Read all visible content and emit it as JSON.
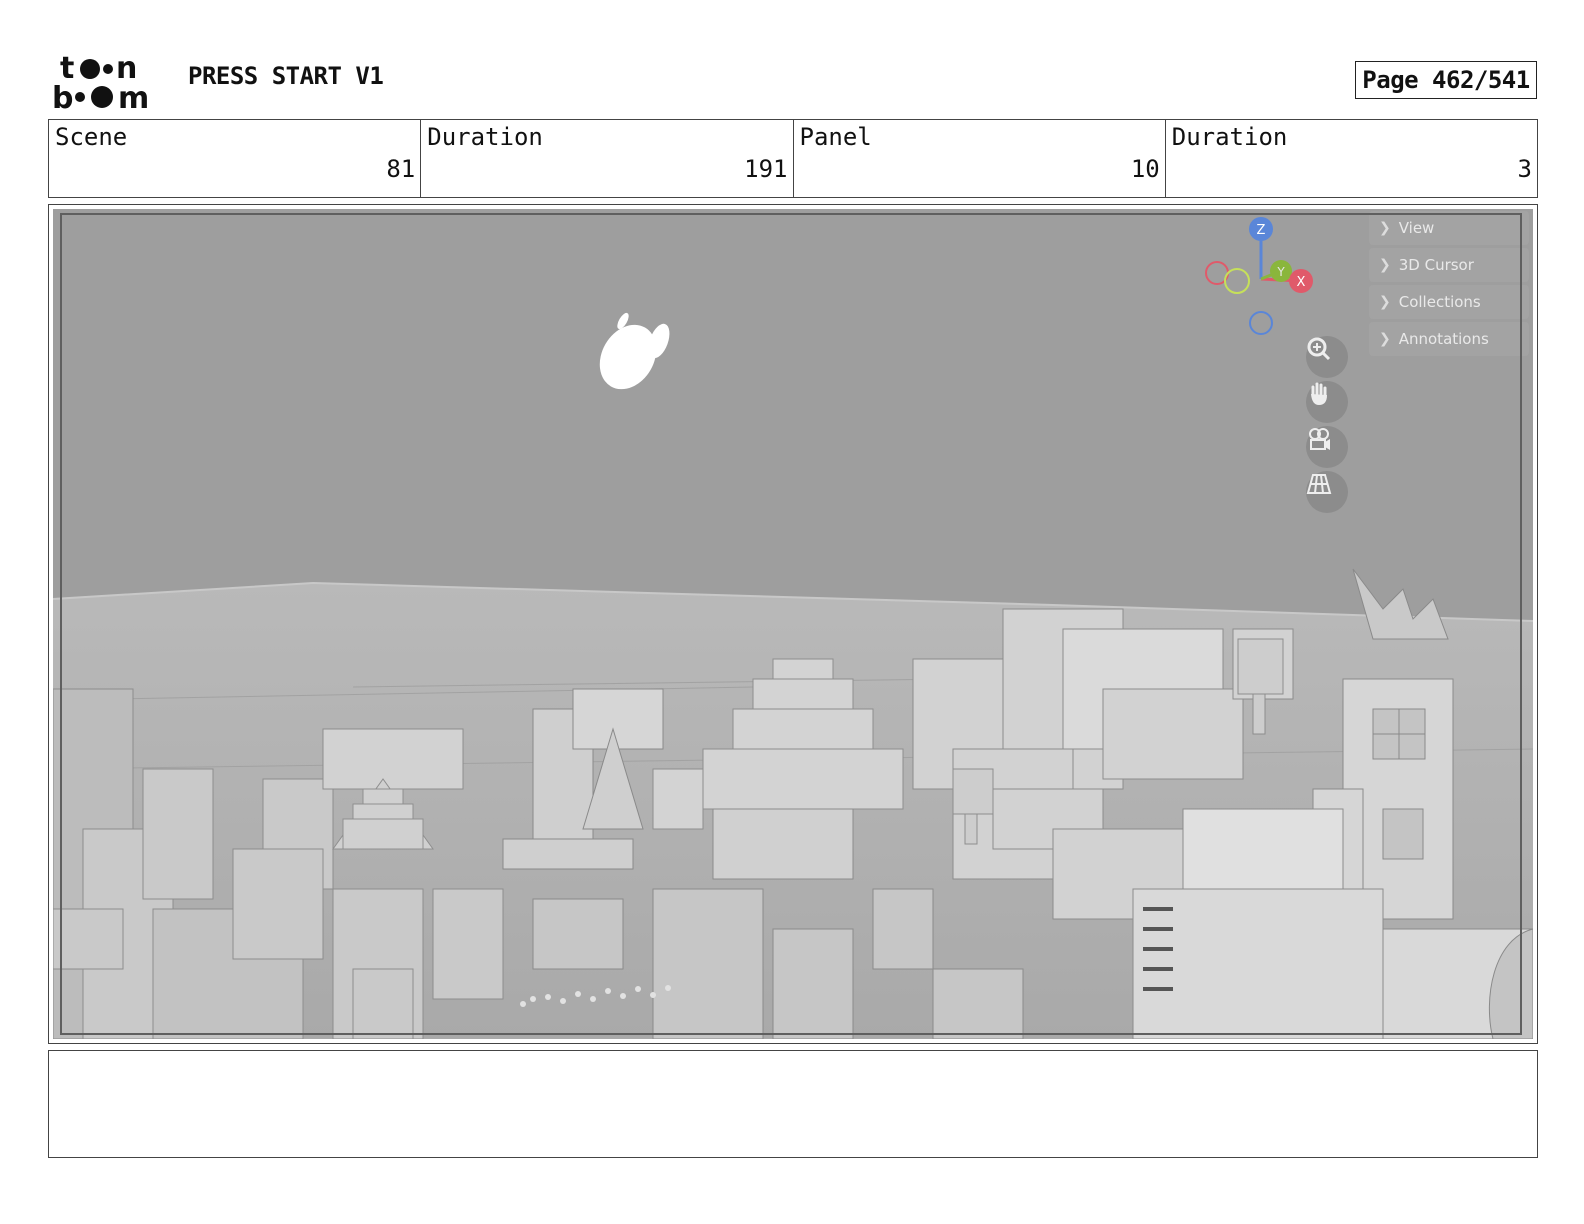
{
  "header": {
    "logo_text": "toon boom",
    "project_title": "PRESS START V1",
    "page_label": "Page 462/541"
  },
  "info": {
    "scene_label": "Scene",
    "scene_value": "81",
    "scene_duration_label": "Duration",
    "scene_duration_value": "191",
    "panel_label": "Panel",
    "panel_value": "10",
    "panel_duration_label": "Duration",
    "panel_duration_value": "3"
  },
  "viewport": {
    "outliner_items": [
      "View",
      "3D Cursor",
      "Collections",
      "Annotations"
    ],
    "gizmo_axes": [
      "Z",
      "Y",
      "X"
    ],
    "nav_buttons": [
      "zoom-icon",
      "hand-pan-icon",
      "camera-icon",
      "grid-perspective-icon"
    ],
    "axis_colors": {
      "x": "#e05a6a",
      "y": "#8ab63c",
      "z": "#5a86d8"
    }
  },
  "notes": {
    "text": ""
  }
}
